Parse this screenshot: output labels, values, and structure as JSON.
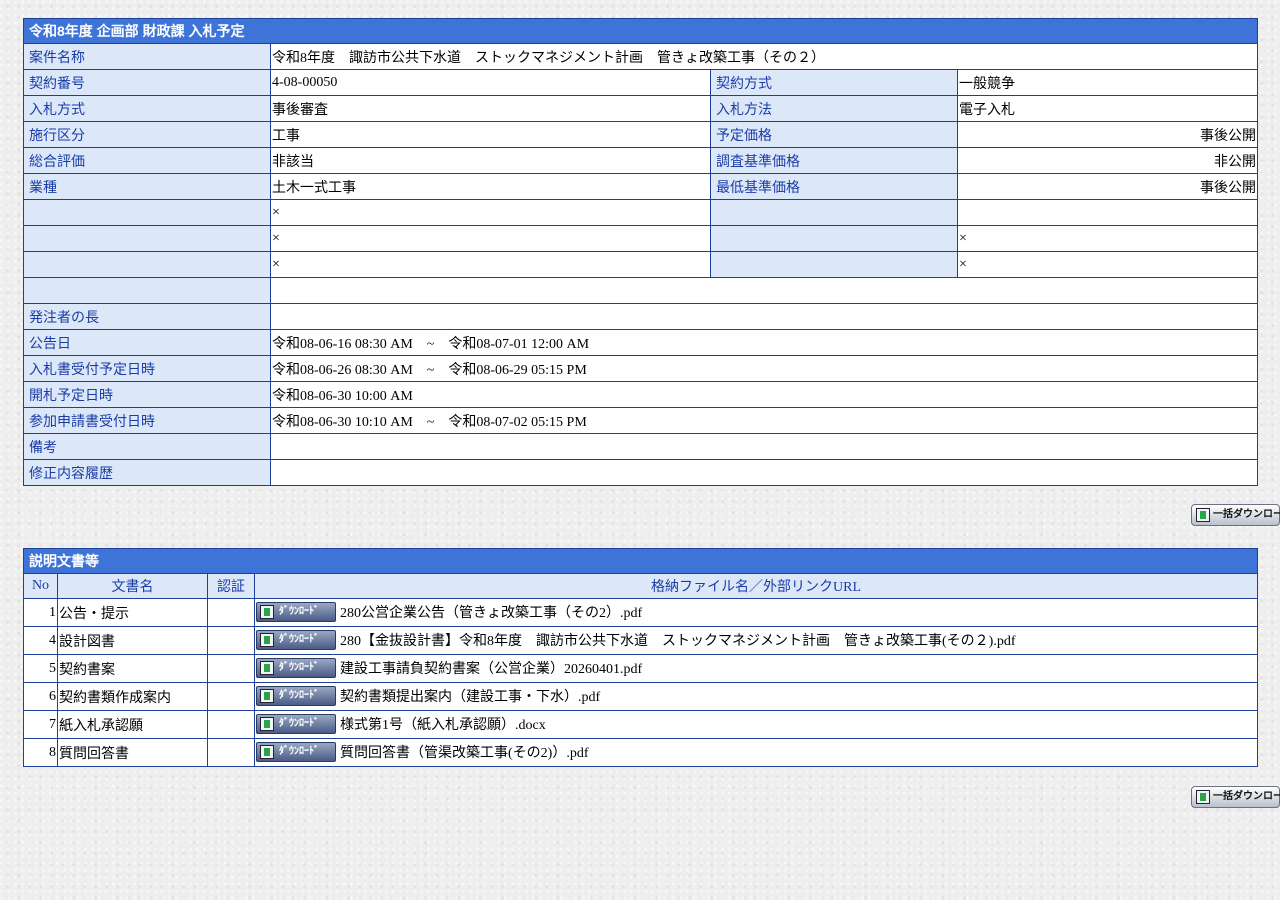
{
  "detail": {
    "title": "令和8年度 企画部 財政課 入札予定",
    "project_name_label": "案件名称",
    "project_name": "令和8年度　諏訪市公共下水道　ストックマネジメント計画　管きょ改築工事（その２）",
    "rows": [
      {
        "l1": "契約番号",
        "v1": "4-08-00050",
        "l2": "契約方式",
        "v2": "一般競争"
      },
      {
        "l1": "入札方式",
        "v1": "事後審査",
        "l2": "入札方法",
        "v2": "電子入札"
      },
      {
        "l1": "施行区分",
        "v1": "工事",
        "l2": "予定価格",
        "v2": "事後公開"
      },
      {
        "l1": "総合評価",
        "v1": "非該当",
        "l2": "調査基準価格",
        "v2": "非公開"
      },
      {
        "l1": "業種",
        "v1": "土木一式工事",
        "l2": "最低基準価格",
        "v2": "事後公開"
      },
      {
        "l1": "",
        "v1": "×",
        "l2": "",
        "v2": ""
      },
      {
        "l1": "",
        "v1": "×",
        "l2": "",
        "v2": "×"
      },
      {
        "l1": "",
        "v1": "×",
        "l2": "",
        "v2": "×"
      }
    ],
    "wide_rows": [
      {
        "label": "",
        "value": ""
      },
      {
        "label": "発注者の長",
        "value": ""
      },
      {
        "label": "公告日",
        "value": "令和08-06-16 08:30 AM　~　令和08-07-01 12:00 AM"
      },
      {
        "label": "入札書受付予定日時",
        "value": "令和08-06-26 08:30 AM　~　令和08-06-29 05:15 PM"
      },
      {
        "label": "開札予定日時",
        "value": "令和08-06-30 10:00 AM"
      },
      {
        "label": "参加申請書受付日時",
        "value": "令和08-06-30 10:10 AM　~　令和08-07-02 05:15 PM"
      },
      {
        "label": "備考",
        "value": ""
      },
      {
        "label": "修正内容履歴",
        "value": ""
      }
    ]
  },
  "bulk_download_label": "一括ダウンロード",
  "docs": {
    "title": "説明文書等",
    "headers": {
      "no": "No",
      "name": "文書名",
      "cert": "認証",
      "file": "格納ファイル名／外部リンクURL"
    },
    "download_label": "ﾀﾞｳﾝﾛｰﾄﾞ",
    "items": [
      {
        "no": "1",
        "name": "公告・提示",
        "cert": "",
        "file": "280公営企業公告（管きょ改築工事（その2）.pdf"
      },
      {
        "no": "4",
        "name": "設計図書",
        "cert": "",
        "file": "280【金抜設計書】令和8年度　諏訪市公共下水道　ストックマネジメント計画　管きょ改築工事(その２).pdf"
      },
      {
        "no": "5",
        "name": "契約書案",
        "cert": "",
        "file": "建設工事請負契約書案（公営企業）20260401.pdf"
      },
      {
        "no": "6",
        "name": "契約書類作成案内",
        "cert": "",
        "file": "契約書類提出案内（建設工事・下水）.pdf"
      },
      {
        "no": "7",
        "name": "紙入札承認願",
        "cert": "",
        "file": "様式第1号（紙入札承認願）.docx"
      },
      {
        "no": "8",
        "name": "質問回答書",
        "cert": "",
        "file": "質問回答書（管渠改築工事(その2)）.pdf"
      }
    ]
  }
}
